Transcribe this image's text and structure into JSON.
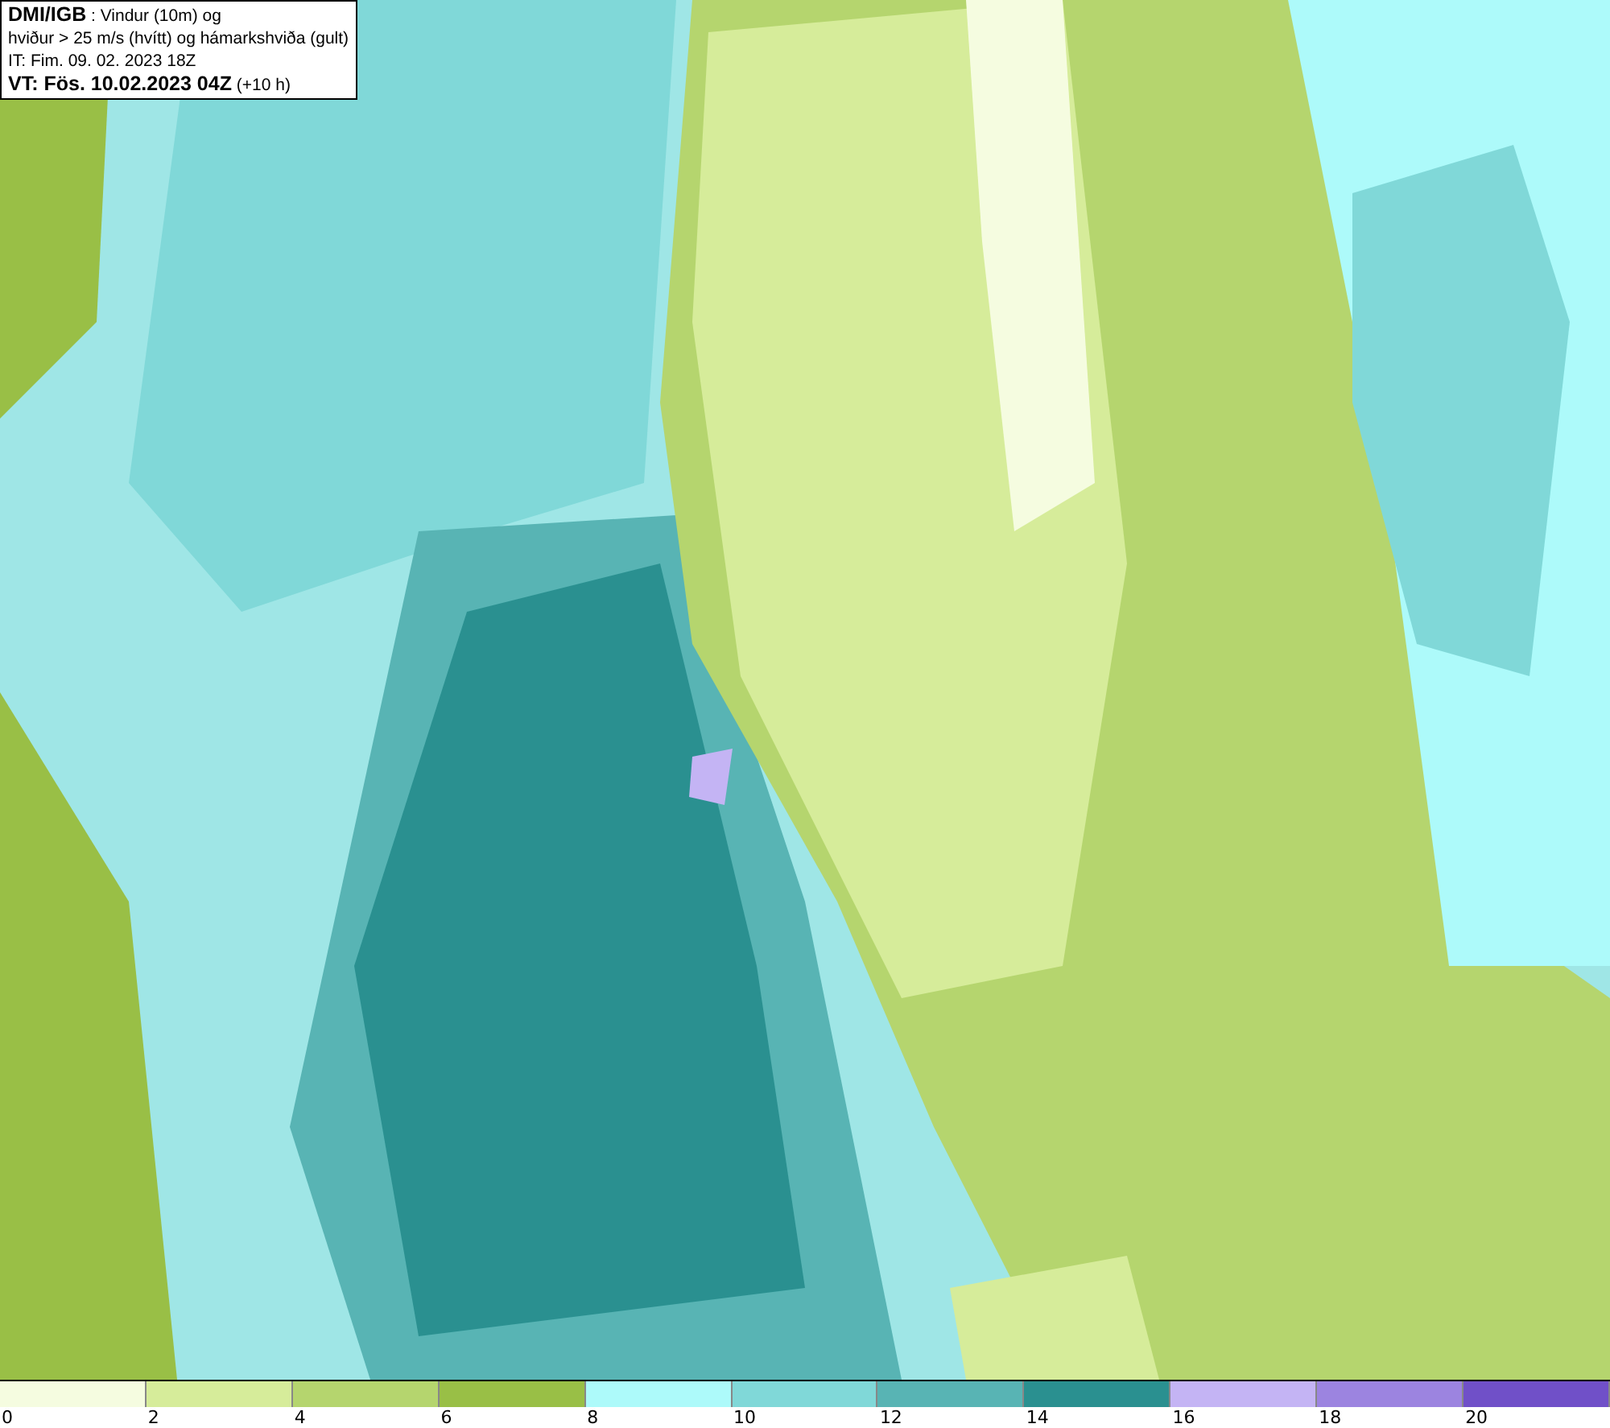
{
  "title_box": {
    "lines": [
      "**DMI/IGB** : Vindur (10m) og",
      "hviður > 25 m/s (hvítt) og hámarkshviða (gult)",
      "IT: Fim. 09. 02. 2023 18Z",
      "**VT: Fös. 10.02.2023 04Z** (+10 h)"
    ]
  },
  "legend": {
    "swatches": [
      {
        "color": "#f5fce0",
        "label": "0"
      },
      {
        "color": "#d6ec9a",
        "label": "2"
      },
      {
        "color": "#b5d56e",
        "label": "4"
      },
      {
        "color": "#99bf46",
        "label": "6"
      },
      {
        "color": "#adfafa",
        "label": "8"
      },
      {
        "color": "#80d8d8",
        "label": "10"
      },
      {
        "color": "#58b4b4",
        "label": "12"
      },
      {
        "color": "#2a9090",
        "label": "14"
      },
      {
        "color": "#c4b4f4",
        "label": "16"
      },
      {
        "color": "#9c84e0",
        "label": "18"
      },
      {
        "color": "#7050c8",
        "label": "20"
      }
    ]
  }
}
